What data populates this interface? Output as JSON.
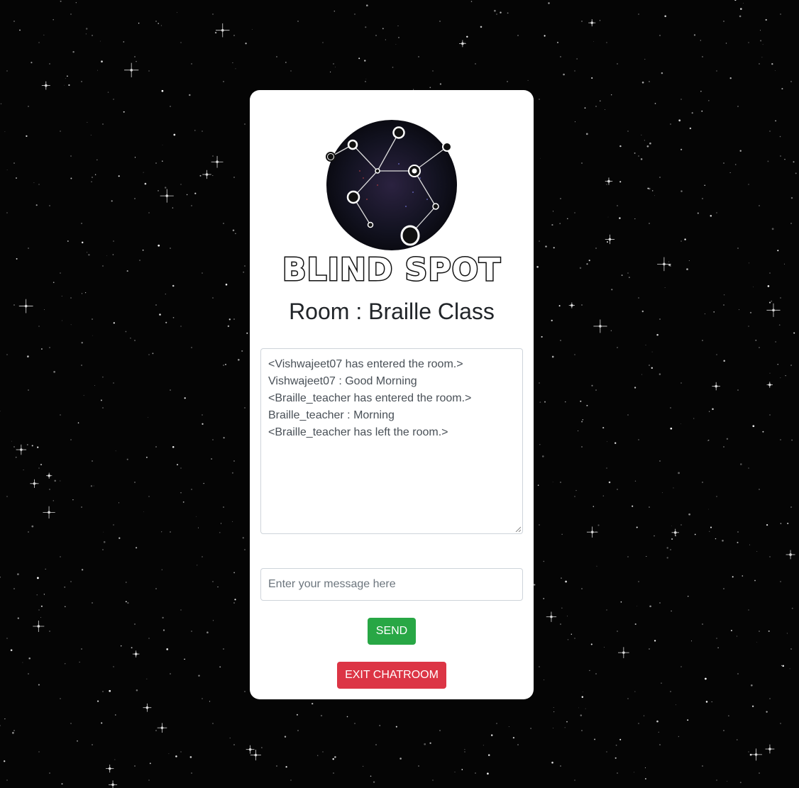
{
  "app": {
    "brand_name": "BLIND SPOT"
  },
  "room": {
    "title": "Room : Braille Class"
  },
  "chat": {
    "messages": [
      "<Vishwajeet07 has entered the room.>",
      "Vishwajeet07 : Good Morning",
      "<Braille_teacher has entered the room.>",
      "Braille_teacher : Morning",
      "<Braille_teacher has left the room.>"
    ]
  },
  "input": {
    "placeholder": "Enter your message here",
    "value": ""
  },
  "buttons": {
    "send_label": "SEND",
    "exit_label": "EXIT CHATROOM"
  },
  "colors": {
    "send": "#28a745",
    "exit": "#dc3545",
    "background": "#050505"
  },
  "icons": {
    "logo": "constellation-logo",
    "resize": "resize-grip-icon"
  }
}
